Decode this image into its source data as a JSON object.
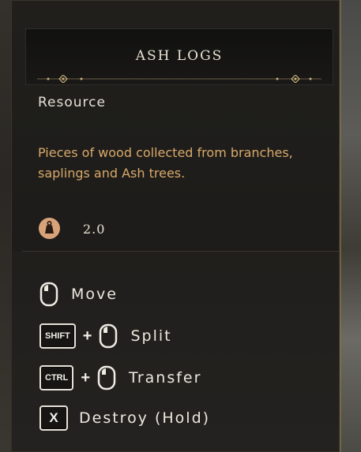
{
  "item": {
    "name": "ASH LOGS",
    "type": "Resource",
    "description": "Pieces of wood collected from branches, saplings and Ash trees.",
    "weight": "2.0"
  },
  "actions": {
    "move": {
      "label": "Move"
    },
    "split": {
      "key": "SHIFT",
      "plus": "+",
      "label": "Split"
    },
    "transfer": {
      "key": "CTRL",
      "plus": "+",
      "label": "Transfer"
    },
    "destroy": {
      "key": "X",
      "label": "Destroy (Hold)"
    }
  },
  "colors": {
    "title_text": "#e8e2d2",
    "description_text": "#d9a96a",
    "weight_icon": "#d9a37a",
    "key_border": "#e6e2d8"
  }
}
